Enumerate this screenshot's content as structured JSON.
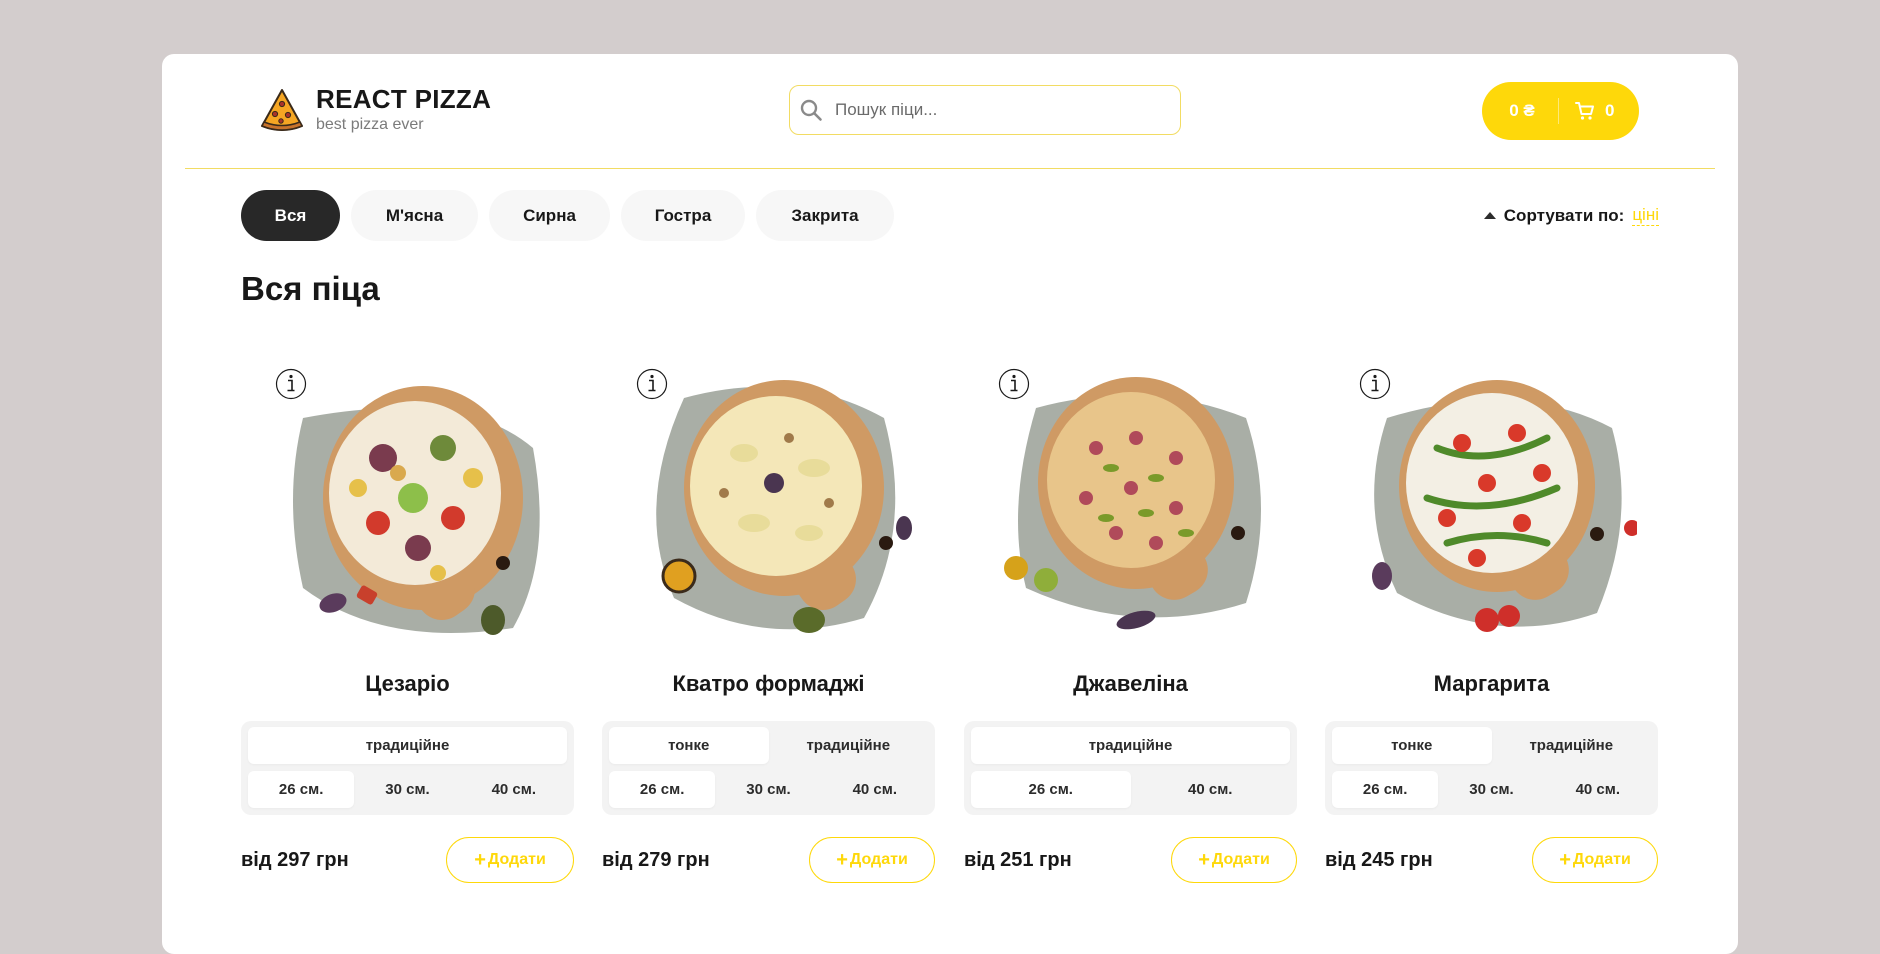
{
  "header": {
    "title": "REACT PIZZA",
    "subtitle": "best pizza ever",
    "search_placeholder": "Пошук піци...",
    "cart_price": "0 ₴",
    "cart_count": "0"
  },
  "categories": [
    "Вся",
    "М'ясна",
    "Сирна",
    "Гостра",
    "Закрита"
  ],
  "sort": {
    "label": "Сортувати по:",
    "value": "ціні"
  },
  "page_title": "Вся піца",
  "pizzas": [
    {
      "name": "Цезаріо",
      "types": [
        "традиційне"
      ],
      "sizes": [
        "26 см.",
        "30 см.",
        "40 см."
      ],
      "price": "від 297 грн",
      "add_label": "Додати"
    },
    {
      "name": "Кватро формаджі",
      "types": [
        "тонке",
        "традиційне"
      ],
      "sizes": [
        "26 см.",
        "30 см.",
        "40 см."
      ],
      "price": "від 279 грн",
      "add_label": "Додати"
    },
    {
      "name": "Джавеліна",
      "types": [
        "традиційне"
      ],
      "sizes": [
        "26 см.",
        "40 см."
      ],
      "price": "від 251 грн",
      "add_label": "Додати"
    },
    {
      "name": "Маргарита",
      "types": [
        "тонке",
        "традиційне"
      ],
      "sizes": [
        "26 см.",
        "30 см.",
        "40 см."
      ],
      "price": "від 245 грн",
      "add_label": "Додати"
    }
  ],
  "icons": {
    "logo": "pizza-slice-icon",
    "search": "search-icon",
    "cart": "cart-icon",
    "info": "info-icon",
    "plus": "plus-icon",
    "sort": "sort-arrow-icon"
  },
  "colors": {
    "accent": "#fed80a",
    "dark": "#282828",
    "background": "#d3cdcd"
  }
}
